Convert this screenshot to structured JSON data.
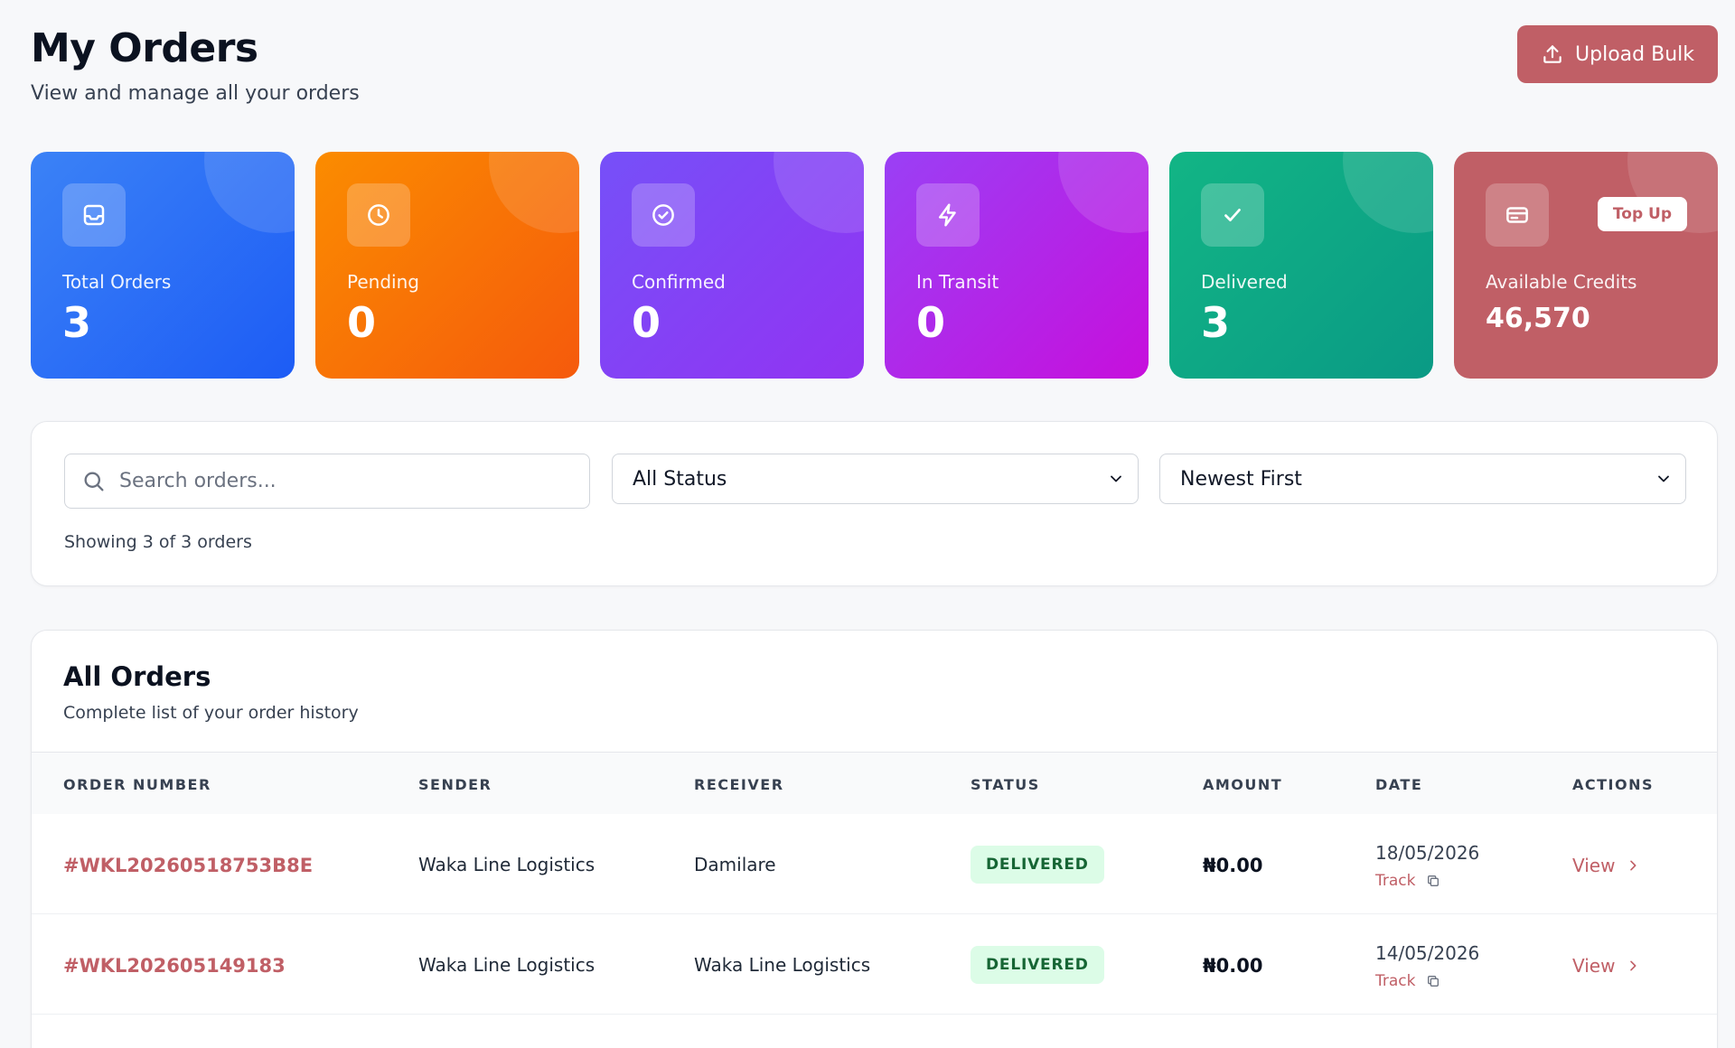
{
  "header": {
    "title": "My Orders",
    "subtitle": "View and manage all your orders",
    "upload_label": "Upload Bulk"
  },
  "stats": [
    {
      "label": "Total Orders",
      "value": "3",
      "icon": "inbox-icon",
      "color_from": "#3b82f6",
      "color_to": "#1d5cf5"
    },
    {
      "label": "Pending",
      "value": "0",
      "icon": "clock-icon",
      "color_from": "#fb8c00",
      "color_to": "#f55a0c"
    },
    {
      "label": "Confirmed",
      "value": "0",
      "icon": "check-circle-icon",
      "color_from": "#7650f8",
      "color_to": "#9233f2"
    },
    {
      "label": "In Transit",
      "value": "0",
      "icon": "lightning-icon",
      "color_from": "#9a40f5",
      "color_to": "#c70fdc"
    },
    {
      "label": "Delivered",
      "value": "3",
      "icon": "check-icon",
      "color_from": "#12b585",
      "color_to": "#0a9a85"
    },
    {
      "label": "Available Credits",
      "value": "46,570",
      "icon": "credit-card-icon",
      "topup_label": "Top Up",
      "color_from": "#c05f66",
      "color_to": "#c05f66"
    }
  ],
  "filters": {
    "search_placeholder": "Search orders...",
    "status_value": "All Status",
    "sort_value": "Newest First",
    "showing_text": "Showing 3 of 3 orders"
  },
  "orders": {
    "title": "All Orders",
    "subtitle": "Complete list of your order history",
    "columns": [
      "ORDER NUMBER",
      "SENDER",
      "RECEIVER",
      "STATUS",
      "AMOUNT",
      "DATE",
      "ACTIONS"
    ],
    "rows": [
      {
        "order_number": "#WKL20260518753B8E",
        "sender": "Waka Line Logistics",
        "receiver": "Damilare",
        "status": "DELIVERED",
        "amount": "₦0.00",
        "date": "18/05/2026",
        "track_label": "Track",
        "view_label": "View"
      },
      {
        "order_number": "#WKL202605149183",
        "sender": "Waka Line Logistics",
        "receiver": "Waka Line Logistics",
        "status": "DELIVERED",
        "amount": "₦0.00",
        "date": "14/05/2026",
        "track_label": "Track",
        "view_label": "View"
      }
    ]
  },
  "colors": {
    "accent": "#c05f66",
    "delivered_badge_bg": "#dcfce7",
    "delivered_badge_text": "#166534"
  }
}
